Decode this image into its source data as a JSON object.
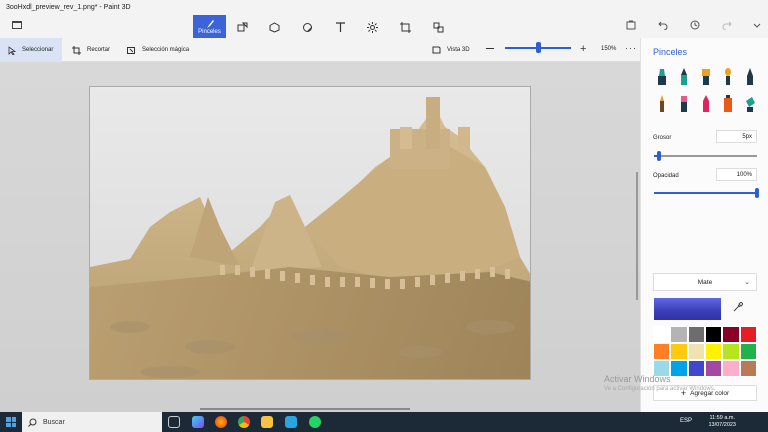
{
  "window": {
    "title": "3ooHxdl_preview_rev_1.png* - Paint 3D"
  },
  "main_tools": {
    "active_label": "Pinceles"
  },
  "toolbar": {
    "select_label": "Seleccionar",
    "crop_label": "Recortar",
    "magic_select_label": "Selección mágica",
    "view3d_label": "Vista 3D",
    "zoom_value": "150%",
    "zoom_level": 0.5
  },
  "panel": {
    "title": "Pinceles",
    "thickness_label": "Grosor",
    "thickness_value": "5px",
    "thickness_level": 0.05,
    "opacity_label": "Opacidad",
    "opacity_value": "100%",
    "opacity_level": 1.0,
    "finish_value": "Mate",
    "current_color": "#3a3fb8",
    "palette": [
      "#ffffff",
      "#b4b4b4",
      "#6d6d6d",
      "#000000",
      "#8b0026",
      "#e51e25",
      "#ff7f27",
      "#ffc90e",
      "#efe4b0",
      "#fff200",
      "#b5e61d",
      "#22b14c",
      "#99d9ea",
      "#00a2e8",
      "#3f48cc",
      "#a349a4",
      "#ffaec9",
      "#b97a57"
    ],
    "add_color_label": "Agregar color"
  },
  "watermark": {
    "line1": "Activar Windows",
    "line2": "Ve a Configuración para activar Windows."
  },
  "taskbar": {
    "search_placeholder": "Buscar",
    "language": "ESP",
    "time": "11:59 a.m.",
    "date": "13/07/2023"
  }
}
